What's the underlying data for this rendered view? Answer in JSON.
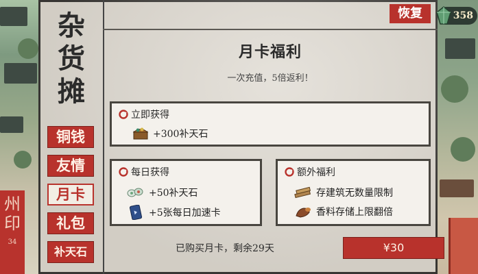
{
  "shop_title": [
    "杂",
    "货",
    "摊"
  ],
  "tabs": [
    "铜钱",
    "友情",
    "月卡",
    "礼包",
    "补天石"
  ],
  "active_tab": "月卡",
  "header": {
    "restore_label": "恢复",
    "jade_count": "358"
  },
  "card": {
    "title": "月卡福利",
    "subtitle": "一次充值，5倍返利！"
  },
  "instant": {
    "heading": "立即获得",
    "items": [
      {
        "icon": "treasure-chest-icon",
        "label": "+300补天石"
      }
    ]
  },
  "daily": {
    "heading": "每日获得",
    "items": [
      {
        "icon": "jade-stones-icon",
        "label": "+50补天石"
      },
      {
        "icon": "speedup-card-icon",
        "label": "+5张每日加速卡"
      }
    ]
  },
  "extra": {
    "heading": "额外福利",
    "items": [
      {
        "icon": "building-materials-icon",
        "label": "存建筑无数量限制"
      },
      {
        "icon": "spice-icon",
        "label": "香料存储上限翻倍"
      }
    ]
  },
  "purchase": {
    "status_text": "已购买月卡，剩余29天",
    "price_label": "¥30"
  },
  "background": {
    "banner_text": "州印",
    "banner_small": "34"
  },
  "colors": {
    "accent_red": "#b8322c",
    "panel_bg": "#ddd8cf",
    "box_bg": "#f4f1ec"
  }
}
